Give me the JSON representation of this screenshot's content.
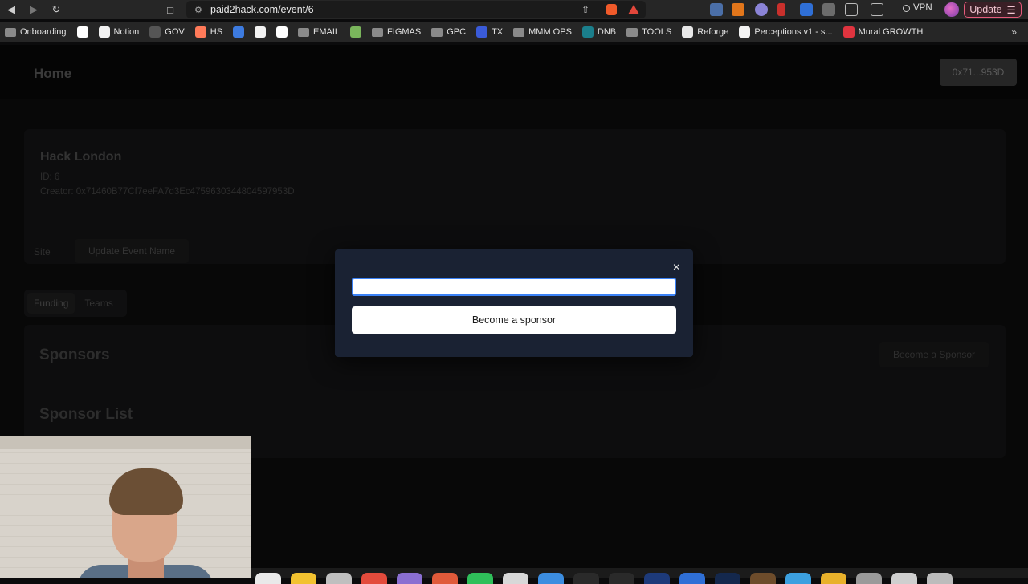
{
  "browser": {
    "url": "paid2hack.com/event/6",
    "vpn_label": "VPN",
    "update_label": "Update"
  },
  "bookmarks": [
    {
      "label": "Onboarding",
      "icon": "folder-icon"
    },
    {
      "label": "",
      "icon": "google-icon"
    },
    {
      "label": "Notion",
      "icon": "notion-icon"
    },
    {
      "label": "GOV",
      "icon": "gov-icon"
    },
    {
      "label": "HS",
      "icon": "hubspot-icon"
    },
    {
      "label": "",
      "icon": "at-icon"
    },
    {
      "label": "",
      "icon": "notion-icon"
    },
    {
      "label": "",
      "icon": "google-icon"
    },
    {
      "label": "EMAIL",
      "icon": "folder-icon"
    },
    {
      "label": "",
      "icon": "shopify-icon"
    },
    {
      "label": "FIGMAS",
      "icon": "folder-icon"
    },
    {
      "label": "GPC",
      "icon": "folder-icon"
    },
    {
      "label": "TX",
      "icon": "tx-icon"
    },
    {
      "label": "MMM OPS",
      "icon": "folder-icon"
    },
    {
      "label": "DNB",
      "icon": "dnb-icon"
    },
    {
      "label": "TOOLS",
      "icon": "folder-icon"
    },
    {
      "label": "Reforge",
      "icon": "reforge-icon"
    },
    {
      "label": "Perceptions v1 - s...",
      "icon": "notion-icon"
    },
    {
      "label": "Mural GROWTH",
      "icon": "mural-icon"
    }
  ],
  "app": {
    "home_label": "Home",
    "wallet_label": "0x71...953D"
  },
  "event": {
    "title": "Hack London",
    "id_line": "ID: 6",
    "creator_line": "Creator: 0x71460B77Cf7eeFA7d3Ec4759630344804597953D",
    "site_label": "Site",
    "update_name_label": "Update Event Name"
  },
  "tabs": [
    {
      "label": "Funding",
      "active": true
    },
    {
      "label": "Teams",
      "active": false
    }
  ],
  "sponsors": {
    "heading": "Sponsors",
    "button_label": "Become a Sponsor",
    "list_heading": "Sponsor List"
  },
  "modal": {
    "input_value": "",
    "submit_label": "Become a sponsor",
    "close_glyph": "×"
  },
  "colors": {
    "modal_bg": "#1a2233",
    "focus_ring": "#3b82f6",
    "update_accent": "#e45a7a"
  }
}
